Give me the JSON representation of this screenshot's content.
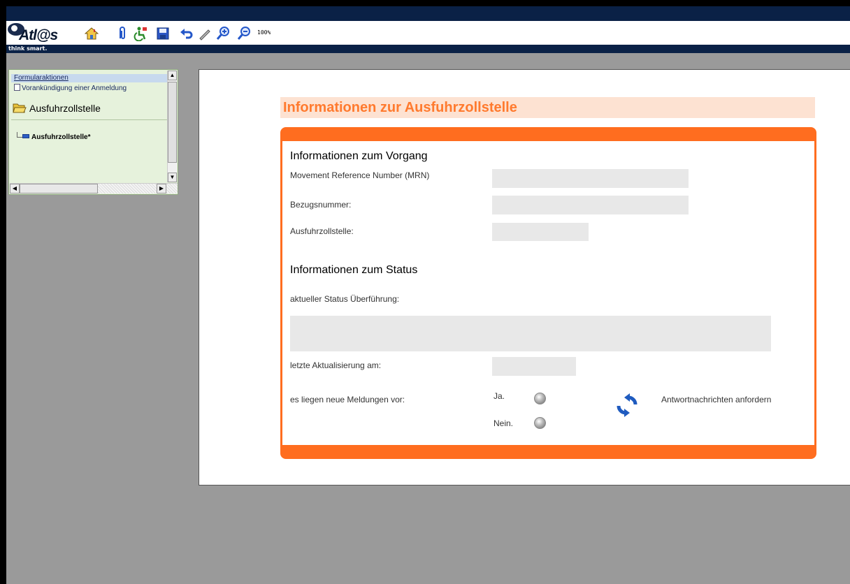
{
  "app": {
    "logo_text": "Atl@s",
    "tagline": "think smart.",
    "zoom": "100%"
  },
  "toolbar": {
    "icons": [
      "home-icon",
      "attachment-icon",
      "accessibility-icon",
      "save-icon",
      "undo-icon",
      "pen-icon",
      "zoom-in-icon",
      "zoom-out-icon"
    ]
  },
  "sidebar": {
    "header": "Formularaktionen",
    "action_item": "Vorankündigung einer Anmeldung",
    "section": "Ausfuhrzollstelle",
    "node": "Ausfuhrzollstelle*"
  },
  "form": {
    "title": "Informationen zur Ausfuhrzollstelle",
    "vorgang": {
      "heading": "Informationen zum Vorgang",
      "mrn_label": "Movement Reference Number (MRN)",
      "mrn_value": "",
      "bezug_label": "Bezugsnummer:",
      "bezug_value": "",
      "zollstelle_label": "Ausfuhrzollstelle:",
      "zollstelle_value": ""
    },
    "status": {
      "heading": "Informationen zum Status",
      "current_label": "aktueller Status Überführung:",
      "current_value": "",
      "updated_label": "letzte Aktualisierung am:",
      "updated_value": "",
      "new_messages_label": "es liegen neue Meldungen vor:",
      "yes_label": "Ja.",
      "no_label": "Nein.",
      "request_label": "Antwortnachrichten anfordern"
    }
  },
  "colors": {
    "accent": "#ff6d1f",
    "title_bg": "#fde2d2",
    "title_text": "#ff7a2e",
    "header_bar": "#0a2146",
    "field_bg": "#e8e8e8"
  }
}
